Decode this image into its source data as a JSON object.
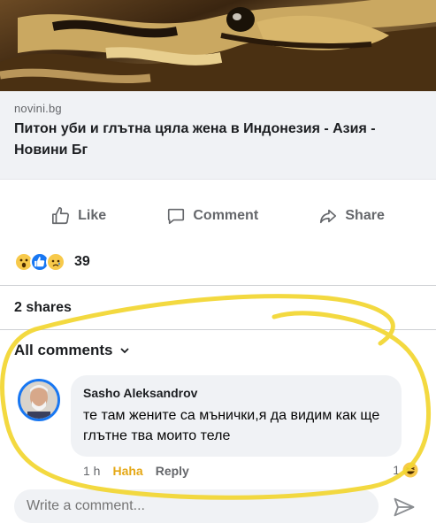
{
  "link_preview": {
    "domain": "novini.bg",
    "title": "Питон уби и глътна цяла жена в Индонезия - Азия - Новини Бг"
  },
  "actions": {
    "like_label": "Like",
    "comment_label": "Comment",
    "share_label": "Share"
  },
  "reactions": {
    "emojis": [
      "wow-icon",
      "like-icon",
      "sad-icon"
    ],
    "count": "39"
  },
  "shares_text": "2 shares",
  "comments_filter": {
    "label": "All comments",
    "icon": "chevron-down-icon"
  },
  "comment": {
    "author": "Sasho Aleksandrov",
    "text": "те там жените са мънички,я да видим как ще глътне тва моито теле",
    "time": "1 h",
    "reaction_label": "Haha",
    "reply_label": "Reply",
    "reaction_count": "1"
  },
  "composer": {
    "placeholder": "Write a comment..."
  },
  "colors": {
    "highlight": "#f2d630",
    "haha": "#e5a816",
    "like_blue": "#1877f2",
    "muted": "#65676b"
  }
}
